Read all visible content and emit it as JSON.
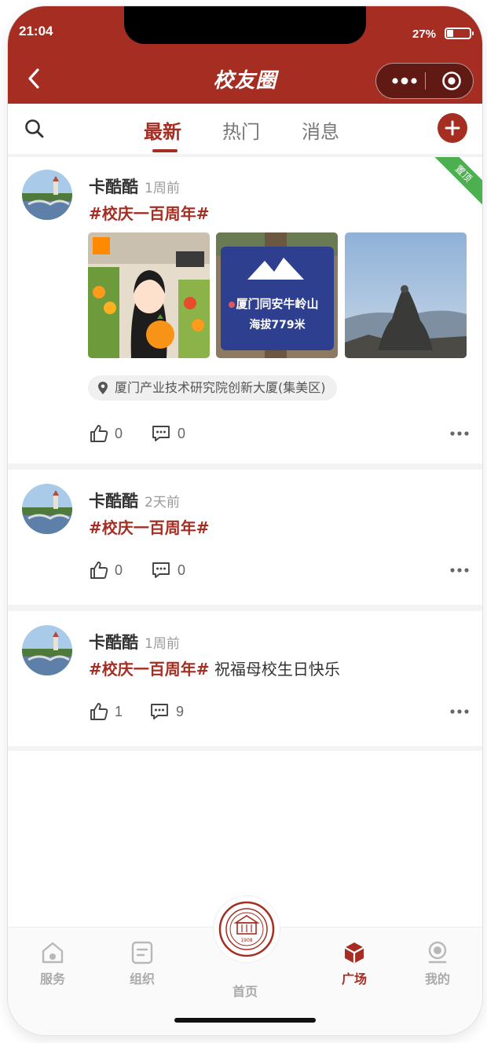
{
  "status_bar": {
    "time": "21:04",
    "battery_text": "27%",
    "battery_level": 0.27
  },
  "nav": {
    "title": "校友圈"
  },
  "tabs": [
    {
      "label": "最新",
      "active": true
    },
    {
      "label": "热门",
      "active": false
    },
    {
      "label": "消息",
      "active": false
    }
  ],
  "posts": [
    {
      "author": "卡酷酷",
      "time": "1周前",
      "hashtag": "#校庆一百周年#",
      "text": "",
      "pinned_label": "置顶",
      "photos": [
        {
          "icon": "girl-with-orange-photo"
        },
        {
          "icon": "mountain-sign-photo",
          "caption_line1": "厦门同安牛岭山",
          "caption_line2": "海拔779米"
        },
        {
          "icon": "stone-cairn-photo"
        }
      ],
      "location": "厦门产业技术研究院创新大厦(集美区)",
      "likes": "0",
      "comments": "0"
    },
    {
      "author": "卡酷酷",
      "time": "2天前",
      "hashtag": "#校庆一百周年#",
      "text": "",
      "likes": "0",
      "comments": "0"
    },
    {
      "author": "卡酷酷",
      "time": "1周前",
      "hashtag": "#校庆一百周年#",
      "text": "祝福母校生日快乐",
      "likes": "1",
      "comments": "9"
    }
  ],
  "bottom_nav": [
    {
      "label": "服务",
      "icon": "service-icon",
      "active": false
    },
    {
      "label": "组织",
      "icon": "organization-icon",
      "active": false
    },
    {
      "label": "首页",
      "icon": "school-emblem-icon",
      "active": false,
      "emblem_year": "1908"
    },
    {
      "label": "广场",
      "icon": "square-cube-icon",
      "active": true
    },
    {
      "label": "我的",
      "icon": "profile-icon",
      "active": false
    }
  ],
  "colors": {
    "brand": "#a52d22",
    "pinned_ribbon": "#4caf50",
    "muted_text": "#999999"
  }
}
